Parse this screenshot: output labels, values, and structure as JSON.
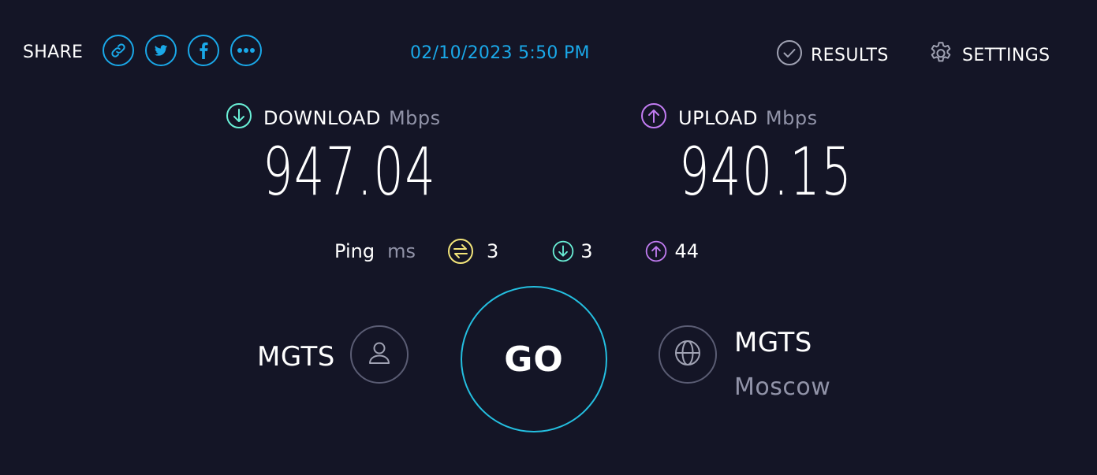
{
  "header": {
    "share_label": "SHARE",
    "share_icons": [
      "link-icon",
      "twitter-icon",
      "facebook-icon",
      "more-icon"
    ],
    "timestamp": "02/10/2023 5:50 PM",
    "results_label": "RESULTS",
    "settings_label": "SETTINGS"
  },
  "download": {
    "label": "DOWNLOAD",
    "unit": "Mbps",
    "value": "947.04",
    "icon": "arrow-down-circle-icon",
    "color": "#6af0d7"
  },
  "upload": {
    "label": "UPLOAD",
    "unit": "Mbps",
    "value": "940.15",
    "icon": "arrow-up-circle-icon",
    "color": "#c27cf2"
  },
  "ping": {
    "label": "Ping",
    "unit": "ms",
    "idle": "3",
    "idle_color": "#f3e57a",
    "download": "3",
    "upload": "44"
  },
  "go_label": "GO",
  "isp": {
    "name": "MGTS",
    "icon": "user-icon"
  },
  "server": {
    "name": "MGTS",
    "location": "Moscow",
    "icon": "globe-icon"
  },
  "colors": {
    "background": "#141526",
    "accent_blue": "#1aa8e8",
    "go_ring": "#24bfe0",
    "muted": "#9193a8"
  }
}
